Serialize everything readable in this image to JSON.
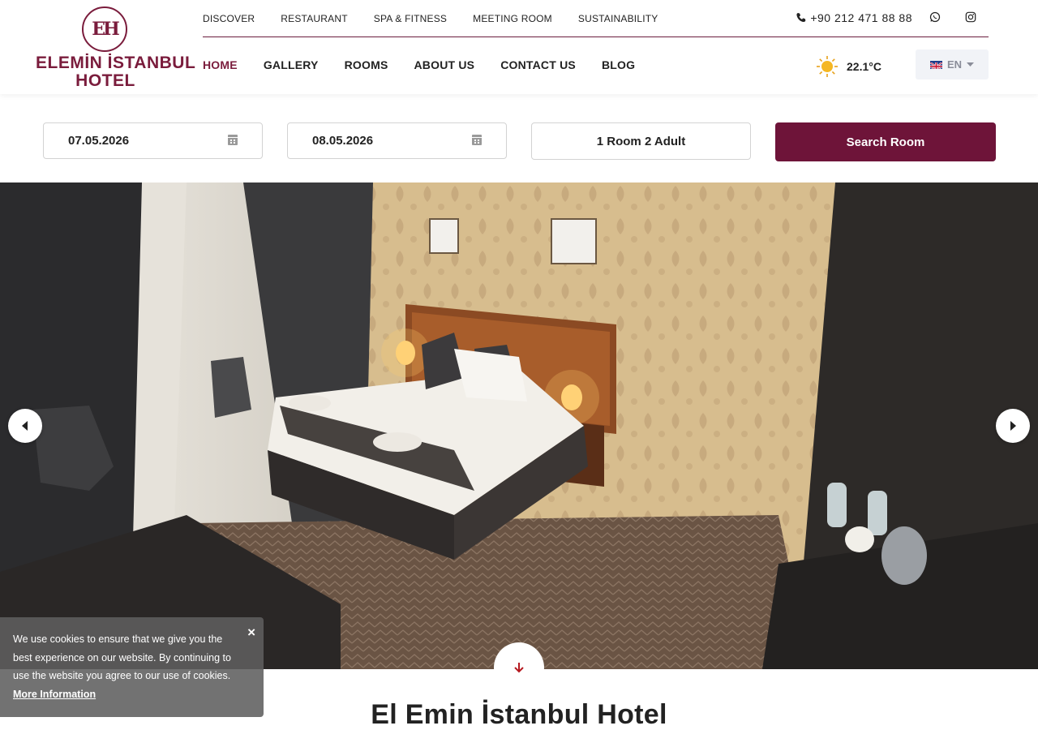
{
  "logo": {
    "mark": "EH",
    "line1": "ELEMİN İSTANBUL",
    "line2": "HOTEL"
  },
  "top_nav": [
    "DISCOVER",
    "RESTAURANT",
    "SPA & FITNESS",
    "MEETING ROOM",
    "SUSTAINABILITY"
  ],
  "main_nav": [
    {
      "label": "HOME",
      "active": true
    },
    {
      "label": "GALLERY",
      "active": false
    },
    {
      "label": "ROOMS",
      "active": false
    },
    {
      "label": "ABOUT US",
      "active": false
    },
    {
      "label": "CONTACT US",
      "active": false
    },
    {
      "label": "BLOG",
      "active": false
    }
  ],
  "contact": {
    "phone": "+90 212 471 88 88",
    "icons": [
      "phone-icon",
      "whatsapp-icon",
      "instagram-icon"
    ]
  },
  "weather": {
    "temperature": "22.1°C",
    "icon": "sun-icon"
  },
  "language": {
    "current": "EN",
    "icon": "uk-flag-icon"
  },
  "booking": {
    "check_in": "07.05.2026",
    "check_out": "08.05.2026",
    "guests": "1 Room 2 Adult",
    "search_label": "Search Room"
  },
  "hero": {
    "icons": [
      "chevron-left-icon",
      "chevron-right-icon",
      "arrow-down-icon"
    ]
  },
  "section_title": "El Emin İstanbul Hotel",
  "cookie": {
    "text": "We use cookies to ensure that we give you the best experience on our website. By continuing to use the website you agree to our use of cookies.",
    "link": "More Information",
    "close": "×"
  },
  "colors": {
    "brand": "#6e1439",
    "accent": "#7a1c3c",
    "cookie_bg": "#5f5f5f"
  }
}
